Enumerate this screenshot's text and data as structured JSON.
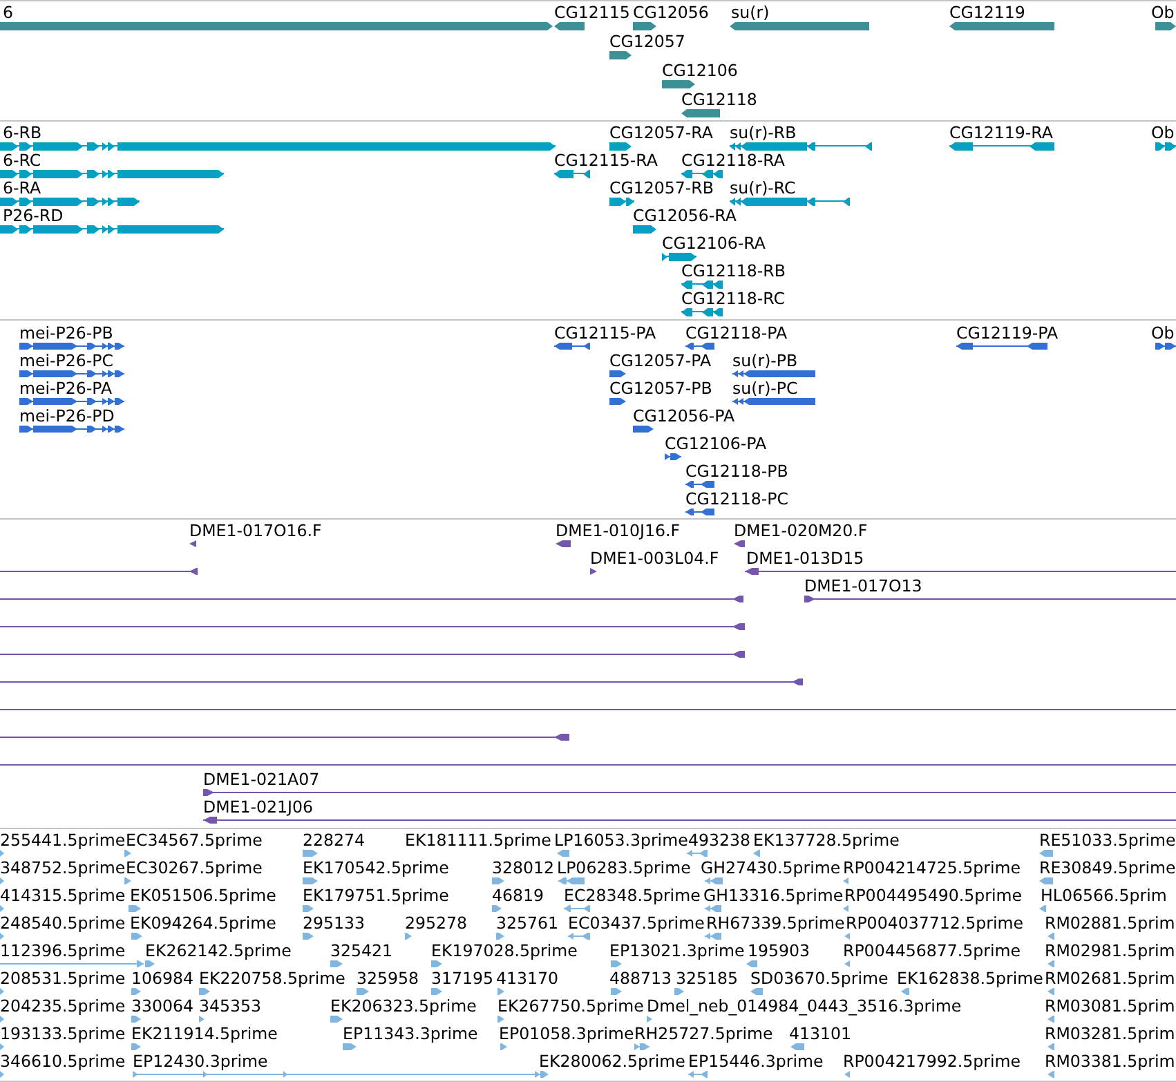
{
  "tracks": [
    {
      "kind": "gene",
      "features": [
        {
          "label": "6",
          "reverse": false
        },
        {
          "label": "CG12115",
          "reverse": true
        },
        {
          "label": "CG12056",
          "reverse": false
        },
        {
          "label": "su(r)",
          "reverse": true
        },
        {
          "label": "CG12119",
          "reverse": true
        },
        {
          "label": "Ob",
          "reverse": false
        },
        {
          "label": "CG12057",
          "reverse": false
        },
        {
          "label": "CG12106",
          "reverse": false
        },
        {
          "label": "CG12118",
          "reverse": true
        }
      ]
    },
    {
      "kind": "transcript",
      "features": [
        {
          "label": "6-RB",
          "reverse": false
        },
        {
          "label": "CG12057-RA",
          "reverse": false
        },
        {
          "label": "su(r)-RB",
          "reverse": true
        },
        {
          "label": "CG12119-RA",
          "reverse": true
        },
        {
          "label": "Ob",
          "reverse": false
        },
        {
          "label": "6-RC",
          "reverse": false
        },
        {
          "label": "CG12115-RA",
          "reverse": true
        },
        {
          "label": "CG12118-RA",
          "reverse": true
        },
        {
          "label": "6-RA",
          "reverse": false
        },
        {
          "label": "CG12057-RB",
          "reverse": false
        },
        {
          "label": "su(r)-RC",
          "reverse": true
        },
        {
          "label": "P26-RD",
          "reverse": false
        },
        {
          "label": "CG12056-RA",
          "reverse": false
        },
        {
          "label": "CG12106-RA",
          "reverse": false
        },
        {
          "label": "CG12118-RB",
          "reverse": true
        },
        {
          "label": "CG12118-RC",
          "reverse": true
        }
      ]
    },
    {
      "kind": "protein",
      "features": [
        {
          "label": "mei-P26-PB",
          "reverse": false
        },
        {
          "label": "CG12115-PA",
          "reverse": true
        },
        {
          "label": "CG12118-PA",
          "reverse": true
        },
        {
          "label": "CG12119-PA",
          "reverse": true
        },
        {
          "label": "Ob",
          "reverse": false
        },
        {
          "label": "mei-P26-PC",
          "reverse": false
        },
        {
          "label": "CG12057-PA",
          "reverse": false
        },
        {
          "label": "su(r)-PB",
          "reverse": true
        },
        {
          "label": "mei-P26-PA",
          "reverse": false
        },
        {
          "label": "CG12057-PB",
          "reverse": false
        },
        {
          "label": "su(r)-PC",
          "reverse": true
        },
        {
          "label": "mei-P26-PD",
          "reverse": false
        },
        {
          "label": "CG12056-PA",
          "reverse": false
        },
        {
          "label": "CG12106-PA",
          "reverse": false
        },
        {
          "label": "CG12118-PB",
          "reverse": true
        },
        {
          "label": "CG12118-PC",
          "reverse": true
        }
      ]
    },
    {
      "kind": "clone",
      "features": [
        {
          "label": "DME1-017O16.F",
          "reverse": true
        },
        {
          "label": "DME1-010J16.F",
          "reverse": true
        },
        {
          "label": "DME1-020M20.F",
          "reverse": true
        },
        {
          "reverse": true
        },
        {
          "label": "DME1-003L04.F",
          "reverse": false
        },
        {
          "label": "DME1-013D15",
          "reverse": true
        },
        {
          "reverse": true
        },
        {
          "label": "DME1-017O13",
          "reverse": false
        },
        {
          "reverse": true
        },
        {
          "reverse": true
        },
        {
          "reverse": true
        },
        {
          "reverse": true
        },
        {
          "label": "DME1-021A07",
          "reverse": false
        },
        {
          "label": "DME1-021J06",
          "reverse": true
        }
      ]
    },
    {
      "kind": "est",
      "features": [
        {
          "label": "255441.5prime",
          "reverse": false
        },
        {
          "label": "EC34567.5prime",
          "reverse": false
        },
        {
          "label": "228274",
          "reverse": false
        },
        {
          "label": "EK181111.5prime"
        },
        {
          "label": "LP16053.3prime",
          "reverse": true
        },
        {
          "label": "493238",
          "reverse": true
        },
        {
          "label": "EK137728.5prime",
          "reverse": true
        },
        {
          "label": "RE51033.5prime",
          "reverse": true
        },
        {
          "label": "348752.5prime",
          "reverse": false
        },
        {
          "label": "EC30267.5prime",
          "reverse": false
        },
        {
          "label": "EK170542.5prime",
          "reverse": false
        },
        {
          "label": "328012",
          "reverse": false
        },
        {
          "label": "LP06283.5prime",
          "reverse": true
        },
        {
          "label": "GH27430.5prime",
          "reverse": true
        },
        {
          "label": "RP004214725.5prime",
          "reverse": true
        },
        {
          "label": "RE30849.5prime",
          "reverse": true
        },
        {
          "label": "414315.5prime",
          "reverse": false
        },
        {
          "label": "EK051506.5prime",
          "reverse": false
        },
        {
          "label": "EK179751.5prime",
          "reverse": false
        },
        {
          "label": "46819",
          "reverse": false
        },
        {
          "label": "EC28348.5prime",
          "reverse": true
        },
        {
          "label": "GH13316.5prime",
          "reverse": true
        },
        {
          "label": "RP004495490.5prime",
          "reverse": true
        },
        {
          "label": "HL06566.5prim",
          "reverse": true
        },
        {
          "label": "248540.5prime",
          "reverse": false
        },
        {
          "label": "EK094264.5prime",
          "reverse": false
        },
        {
          "label": "295133",
          "reverse": false
        },
        {
          "label": "295278",
          "reverse": false
        },
        {
          "label": "325761",
          "reverse": false
        },
        {
          "label": "EC03437.5prime",
          "reverse": true
        },
        {
          "label": "RH67339.5prime",
          "reverse": true
        },
        {
          "label": "RP004037712.5prime",
          "reverse": true
        },
        {
          "label": "RM02881.5prim",
          "reverse": true
        },
        {
          "label": "112396.5prime",
          "reverse": false
        },
        {
          "label": "EK262142.5prime",
          "reverse": false
        },
        {
          "label": "325421",
          "reverse": false
        },
        {
          "label": "EK197028.5prime",
          "reverse": false
        },
        {
          "label": "EP13021.3prime",
          "reverse": false
        },
        {
          "label": "195903",
          "reverse": true
        },
        {
          "label": "RP004456877.5prime",
          "reverse": true
        },
        {
          "label": "RM02981.5prim",
          "reverse": true
        },
        {
          "label": "208531.5prime",
          "reverse": false
        },
        {
          "label": "106984",
          "reverse": false
        },
        {
          "label": "EK220758.5prime",
          "reverse": false
        },
        {
          "label": "325958",
          "reverse": false
        },
        {
          "label": "317195",
          "reverse": false
        },
        {
          "label": "413170",
          "reverse": false
        },
        {
          "label": "488713",
          "reverse": false
        },
        {
          "label": "325185",
          "reverse": false
        },
        {
          "label": "SD03670.5prime",
          "reverse": true
        },
        {
          "label": "EK162838.5prime",
          "reverse": true
        },
        {
          "label": "RM02681.5prim",
          "reverse": true
        },
        {
          "label": "204235.5prime",
          "reverse": false
        },
        {
          "label": "330064",
          "reverse": false
        },
        {
          "label": "345353",
          "reverse": false
        },
        {
          "label": "EK206323.5prime",
          "reverse": false
        },
        {
          "label": "EK267750.5prime",
          "reverse": false
        },
        {
          "label": "Dmel_neb_014984_0443_3516.3prime",
          "reverse": false
        },
        {
          "label": "RM03081.5prim",
          "reverse": true
        },
        {
          "label": "193133.5prime",
          "reverse": false
        },
        {
          "label": "EK211914.5prime",
          "reverse": false
        },
        {
          "label": "EP11343.3prime",
          "reverse": false
        },
        {
          "label": "EP01058.3prime",
          "reverse": false
        },
        {
          "label": "RH25727.5prime",
          "reverse": false
        },
        {
          "label": "413101",
          "reverse": true
        },
        {
          "label": "RM03281.5prim",
          "reverse": true
        },
        {
          "label": "346610.5prime",
          "reverse": false
        },
        {
          "label": "EP12430.3prime",
          "reverse": false
        },
        {
          "label": "EK280062.5prime",
          "reverse": false
        },
        {
          "label": "EP15446.3prime",
          "reverse": true
        },
        {
          "label": "RP004217992.5prime",
          "reverse": true
        },
        {
          "label": "RM03381.5prim",
          "reverse": true
        }
      ]
    }
  ]
}
